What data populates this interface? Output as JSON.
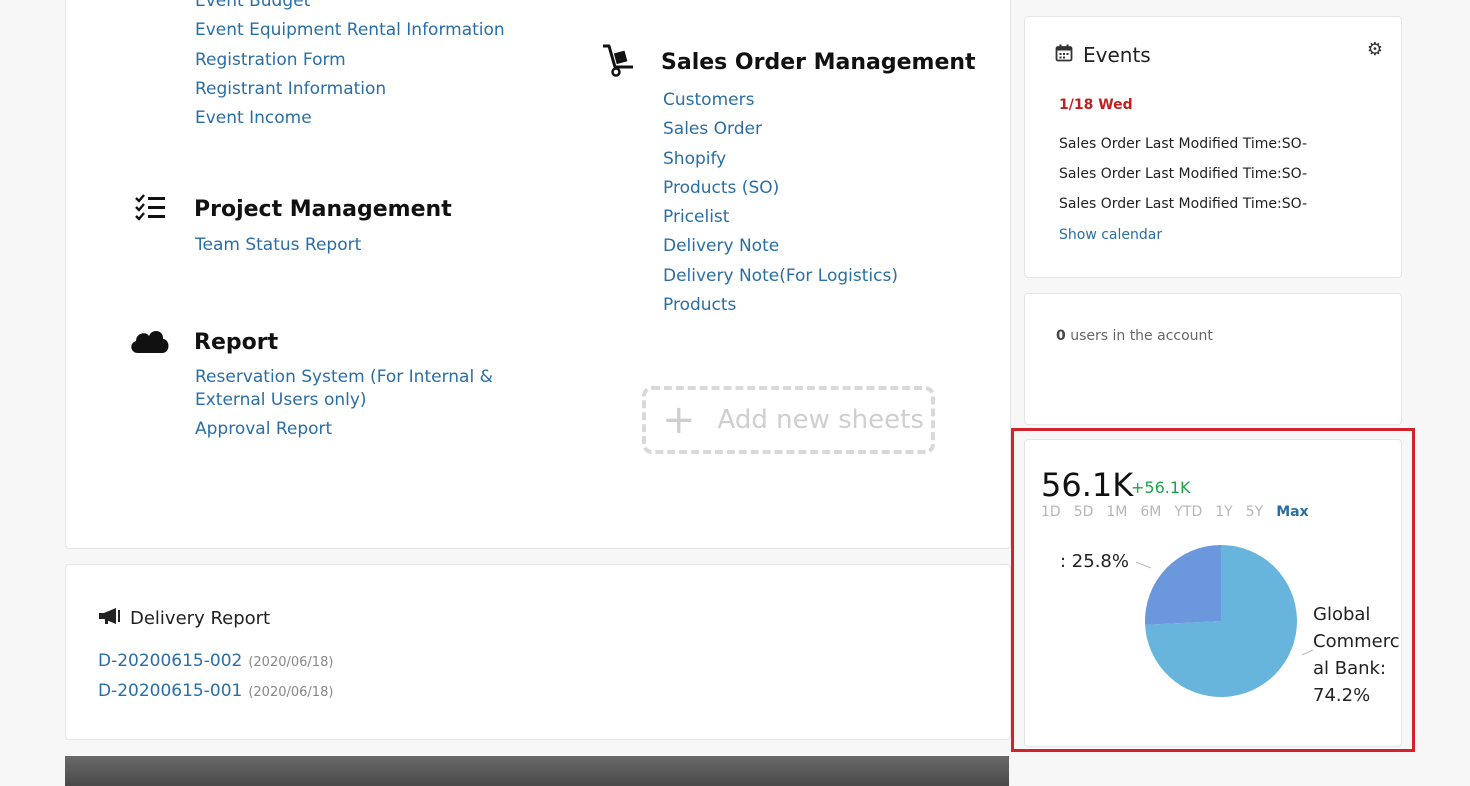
{
  "modules": {
    "event": {
      "links": [
        "Event Budget",
        "Event Equipment Rental Information",
        "Registration Form",
        "Registrant Information",
        "Event Income"
      ]
    },
    "project": {
      "title": "Project Management",
      "icon": "checklist-icon",
      "links": [
        "Team Status Report"
      ]
    },
    "report": {
      "title": "Report",
      "icon": "cloud-icon",
      "links": [
        "Reservation System (For Internal &",
        "External Users only)",
        "Approval Report"
      ]
    },
    "sales": {
      "title": "Sales Order Management",
      "icon": "hand-truck-icon",
      "links": [
        "Customers",
        "Sales Order",
        "Shopify",
        "Products (SO)",
        "Pricelist",
        "Delivery Note",
        "Delivery Note(For Logistics)",
        "Products"
      ]
    },
    "add_sheet": {
      "label": "Add new sheets"
    }
  },
  "delivery": {
    "title": "Delivery Report",
    "icon": "megaphone-icon",
    "rows": [
      {
        "id": "D-20200615-002",
        "date": "(2020/06/18)"
      },
      {
        "id": "D-20200615-001",
        "date": "(2020/06/18)"
      }
    ]
  },
  "events": {
    "title": "Events",
    "icon": "calendar-icon",
    "date": "1/18 Wed",
    "items": [
      "Sales Order Last Modified Time:SO-",
      "Sales Order Last Modified Time:SO-",
      "Sales Order Last Modified Time:SO-"
    ],
    "show_calendar": "Show calendar"
  },
  "users": {
    "count": "0",
    "suffix": " users in the account"
  },
  "widget": {
    "value": "56.1K",
    "change": "+56.1K",
    "ranges": [
      "1D",
      "5D",
      "1M",
      "6M",
      "YTD",
      "1Y",
      "5Y",
      "Max"
    ],
    "active_range": "Max"
  },
  "chart_data": {
    "type": "pie",
    "slices": [
      {
        "label": "Global Commercial Bank",
        "value": 74.2,
        "color": "#67b5dc"
      },
      {
        "label": "",
        "value": 25.8,
        "color": "#6b97dc"
      }
    ],
    "labels_text": [
      ": 25.8%",
      "Global",
      "Commerc",
      "al Bank:",
      "74.2%"
    ]
  }
}
